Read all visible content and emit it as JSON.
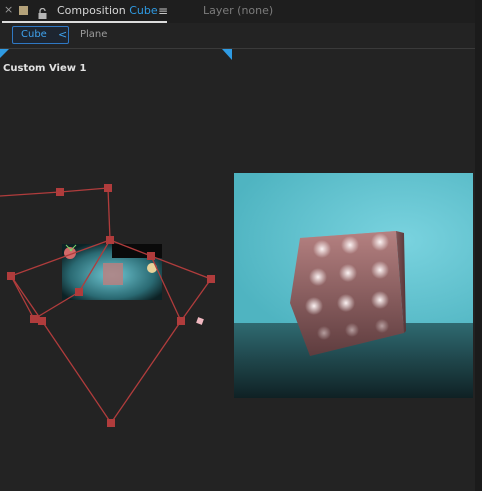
{
  "tab": {
    "close_glyph": "×",
    "swatch_color": "#b4a27a",
    "lock_icon": "lock-icon",
    "composition_prefix": "Composition",
    "composition_name": "Cube",
    "menu_glyph": "≡",
    "layer_label": "Layer (none)"
  },
  "breadcrumb": {
    "active": "Cube",
    "chevron": "<",
    "next": "Plane"
  },
  "viewer": {
    "view_name": "Custom View 1",
    "accent_color": "#2f9be3",
    "camera_color": "#b03c3c",
    "render": {
      "background": "#5cc3d0",
      "floor": "#27565d",
      "cube_color": "#b78080",
      "dot_color": "#f2e8e8"
    }
  }
}
